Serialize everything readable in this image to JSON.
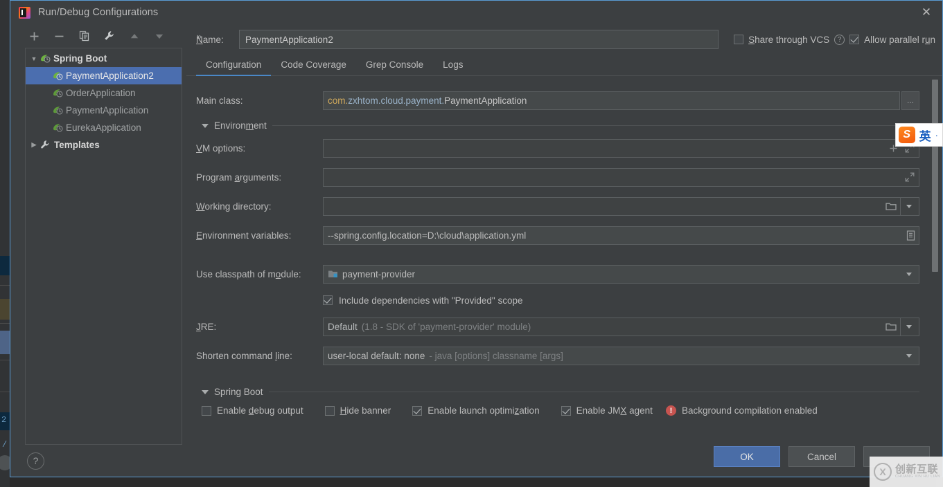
{
  "window": {
    "title": "Run/Debug Configurations",
    "app_icon": "intellij-idea-logo",
    "close_icon": "close-icon"
  },
  "toolbar": {
    "add_label": "+",
    "remove_label": "−",
    "copy_label": "copy-icon",
    "edit_templates_label": "wrench-icon",
    "move_up_label": "arrow-up-icon",
    "move_down_label": "arrow-down-icon",
    "overflow_label": "»"
  },
  "tree": {
    "groups": [
      {
        "label": "Spring Boot",
        "expanded": true,
        "arrow": "▼",
        "icon": "spring-boot-icon",
        "children": [
          {
            "label": "PaymentApplication2",
            "selected": true,
            "icon": "spring-boot-icon"
          },
          {
            "label": "OrderApplication",
            "selected": false,
            "icon": "spring-boot-icon"
          },
          {
            "label": "PaymentApplication",
            "selected": false,
            "icon": "spring-boot-icon"
          },
          {
            "label": "EurekaApplication",
            "selected": false,
            "icon": "spring-boot-icon"
          }
        ]
      },
      {
        "label": "Templates",
        "expanded": false,
        "arrow": "▶",
        "icon": "wrench-icon",
        "children": []
      }
    ]
  },
  "help_button": {
    "label": "?"
  },
  "name_row": {
    "label": "Name:",
    "label_mnemonic": "N",
    "value": "PaymentApplication2",
    "placeholder": "",
    "share_through_vcs": {
      "label": "Share through VCS",
      "mnemonic": "S",
      "checked": false
    },
    "share_help": "?",
    "allow_parallel_run": {
      "label": "Allow parallel run",
      "mnemonic": "u",
      "checked": true
    }
  },
  "tabs": [
    {
      "label": "Configuration",
      "active": true
    },
    {
      "label": "Code Coverage",
      "active": false
    },
    {
      "label": "Grep Console",
      "active": false
    },
    {
      "label": "Logs",
      "active": false
    }
  ],
  "form": {
    "main_class": {
      "label": "Main class:",
      "value_package_a": "com.",
      "value_package_b": "zxhtom.cloud.payment.",
      "value_class": "PaymentApplication",
      "browse_label": "...",
      "browse_icon": "ellipsis-icon"
    },
    "environment_section": {
      "label": "Environment",
      "mnemonic": "m",
      "expanded": true,
      "arrow": "▼"
    },
    "vm_options": {
      "label": "VM options:",
      "mnemonic": "V",
      "value": "",
      "add_icon": "plus-icon",
      "expand_icon": "expand-icon"
    },
    "program_arguments": {
      "label": "Program arguments:",
      "mnemonic": "a",
      "value": "",
      "expand_icon": "expand-icon"
    },
    "working_directory": {
      "label": "Working directory:",
      "mnemonic": "W",
      "value": "",
      "browse_icon": "folder-icon",
      "dropdown_icon": "chevron-down-icon"
    },
    "environment_variables": {
      "label": "Environment variables:",
      "mnemonic": "E",
      "value": "--spring.config.location=D:\\cloud\\application.yml",
      "edit_icon": "list-edit-icon"
    },
    "use_classpath_of_module": {
      "label": "Use classpath of module:",
      "mnemonic": "o",
      "value": "payment-provider",
      "module_icon": "module-icon",
      "dropdown_icon": "chevron-down-icon"
    },
    "include_dependencies": {
      "label": "Include dependencies with \"Provided\" scope",
      "checked": true
    },
    "jre": {
      "label": "JRE:",
      "mnemonic": "J",
      "value": "Default",
      "value_hint": "(1.8 - SDK of 'payment-provider' module)",
      "browse_icon": "folder-icon",
      "dropdown_icon": "chevron-down-icon"
    },
    "shorten_command_line": {
      "label": "Shorten command line:",
      "mnemonic": "l",
      "value": "user-local default: none",
      "value_hint": "- java [options] classname [args]",
      "dropdown_icon": "chevron-down-icon"
    },
    "spring_boot_section": {
      "label": "Spring Boot",
      "mnemonic": "g",
      "expanded": true,
      "arrow": "▼"
    },
    "spring_boot_options": [
      {
        "label": "Enable debug output",
        "mnemonic": "d",
        "checked": false,
        "name": "enable-debug-output"
      },
      {
        "label": "Hide banner",
        "mnemonic": "i",
        "checked": false,
        "name": "hide-banner"
      },
      {
        "label": "Enable launch optimization",
        "mnemonic": "z",
        "checked": true,
        "name": "enable-launch-optimization"
      },
      {
        "label": "Enable JMX agent",
        "mnemonic": "X",
        "checked": true,
        "name": "enable-jmx-agent"
      }
    ],
    "background_compilation": {
      "icon": "error-icon",
      "label": "Background compilation enabled"
    }
  },
  "footer": {
    "ok_label": "OK",
    "cancel_label": "Cancel",
    "apply_label": ""
  },
  "watermarks": {
    "sogou": {
      "logo": "S",
      "mode": "英",
      "dot": "·"
    },
    "chuangxin": {
      "mark": "X",
      "cn": "创新互联",
      "en": "CHUANG XIN HU LIAN"
    }
  },
  "colors": {
    "accent_blue": "#4a88c7",
    "selection_blue": "#4b6eaf",
    "primary_button": "#4a6da7",
    "error_red": "#c75450",
    "dialog_bg": "#3c3f41",
    "field_bg": "#45494a"
  }
}
